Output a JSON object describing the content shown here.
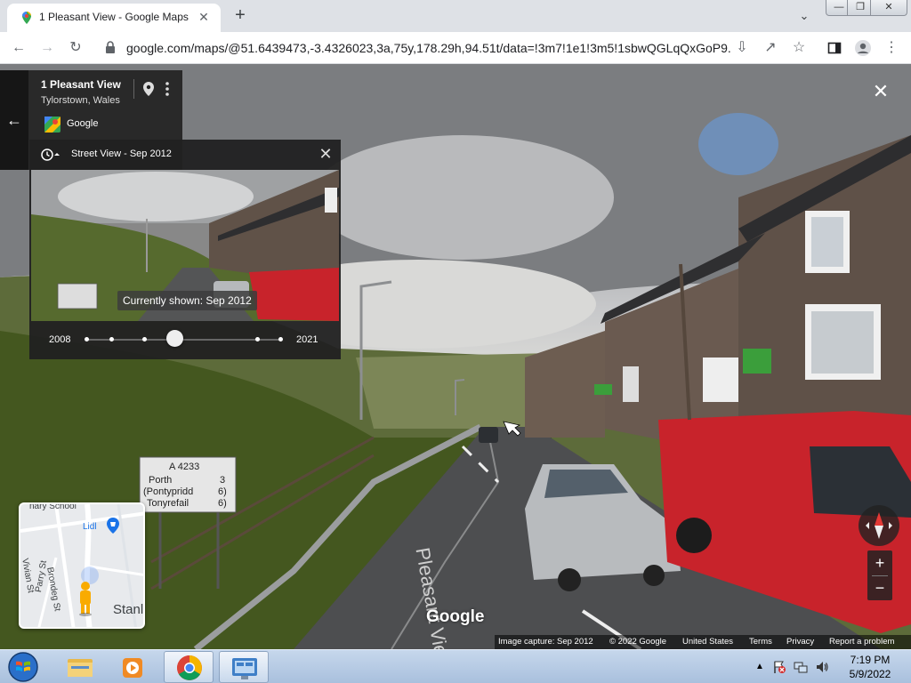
{
  "browser": {
    "tab_title": "1 Pleasant View - Google Maps",
    "tab_close": "✕",
    "new_tab": "+",
    "url": "google.com/maps/@51.6439473,-3.4326023,3a,75y,178.29h,94.51t/data=!3m7!1e1!3m5!1sbwQGLqQxGoP9...",
    "window_controls": {
      "minimize": "—",
      "maximize": "❐",
      "close": "✕"
    }
  },
  "place_card": {
    "title": "1 Pleasant View",
    "subtitle": "Tylorstown, Wales",
    "attribution": "Google",
    "back": "←"
  },
  "time_travel": {
    "header": "Street View - Sep 2012",
    "currently_shown": "Currently shown: Sep 2012",
    "start_year": "2008",
    "end_year": "2021",
    "close": "✕",
    "selected_fraction": 0.45
  },
  "street_view": {
    "close": "✕",
    "zoom_in": "+",
    "zoom_out": "−",
    "logo": "Google",
    "road_sign": [
      "A 4233",
      "Porth",
      "3",
      "(Pontypridd",
      "6)",
      "Tonyrefail",
      "6)"
    ],
    "road_marking": "Pleasant View"
  },
  "minimap": {
    "labels": [
      "nary School",
      "Lidl",
      "Vivian St",
      "Brondeg St",
      "Parry St",
      "Stanl"
    ]
  },
  "footer": {
    "capture": "Image capture: Sep 2012",
    "copyright": "© 2022 Google",
    "country": "United States",
    "terms": "Terms",
    "privacy": "Privacy",
    "report": "Report a problem"
  },
  "taskbar": {
    "time": "7:19 PM",
    "date": "5/9/2022"
  },
  "colors": {
    "accent_blue": "#4285f4",
    "van_red": "#c8232b",
    "panel_dark": "#212121"
  }
}
